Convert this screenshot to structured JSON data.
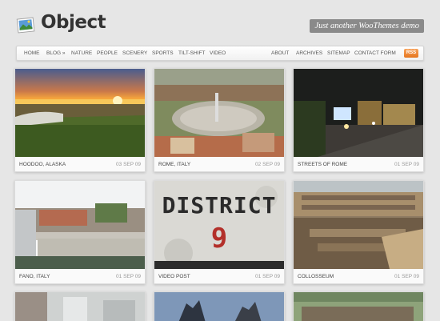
{
  "site": {
    "title": "Object",
    "tagline": "Just another WooThemes demo"
  },
  "nav": {
    "left": [
      "HOME",
      "BLOG »",
      "NATURE",
      "PEOPLE",
      "SCENERY",
      "SPORTS",
      "TILT-SHIFT",
      "VIDEO"
    ],
    "right": [
      "ABOUT",
      "ARCHIVES",
      "SITEMAP",
      "CONTACT FORM"
    ],
    "rss_label": "RSS"
  },
  "posts": [
    {
      "title": "HOODOO, ALASKA",
      "date": "03 SEP 09",
      "image": "sunset-landscape"
    },
    {
      "title": "ROME, ITALY",
      "date": "02 SEP 09",
      "image": "vatican-square"
    },
    {
      "title": "STREETS OF ROME",
      "date": "01 SEP 09",
      "image": "night-street"
    },
    {
      "title": "FANO, ITALY",
      "date": "01 SEP 09",
      "image": "harbor"
    },
    {
      "title": "VIDEO POST",
      "date": "01 SEP 09",
      "image": "district-9-poster",
      "poster_line1": "DISTRICT",
      "poster_line2": "9"
    },
    {
      "title": "COLLOSSEUM",
      "date": "01 SEP 09",
      "image": "colosseum"
    },
    {
      "title": "",
      "date": "",
      "image": "people-partial"
    },
    {
      "title": "",
      "date": "",
      "image": "statue-partial"
    },
    {
      "title": "",
      "date": "",
      "image": "crowd-partial"
    }
  ],
  "colors": {
    "background": "#e6e6e6",
    "rss": "#e6761e",
    "tagline_bg": "#8a8a8a"
  }
}
